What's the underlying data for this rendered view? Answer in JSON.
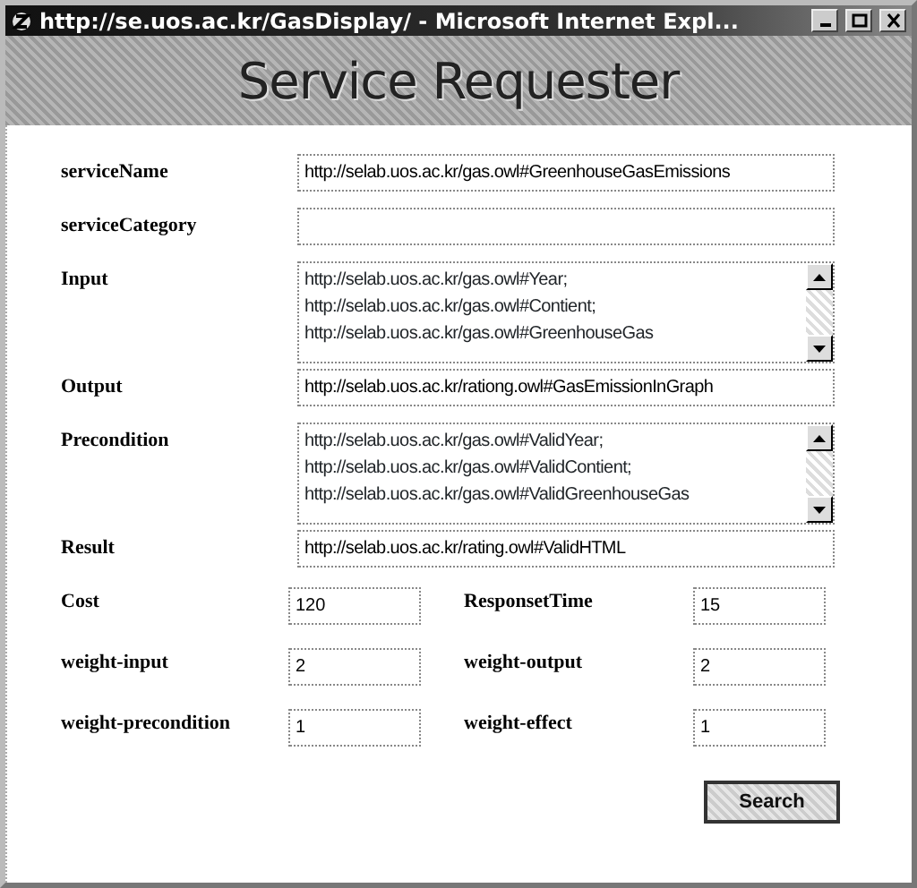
{
  "window": {
    "title": "http://se.uos.ac.kr/GasDisplay/ - Microsoft Internet Expl..."
  },
  "header": {
    "title": "Service Requester"
  },
  "fields": [
    {
      "label": "serviceName",
      "kind": "text",
      "value": "http://selab.uos.ac.kr/gas.owl#GreenhouseGasEmissions"
    },
    {
      "label": "serviceCategory",
      "kind": "text"
    },
    {
      "label": "Input",
      "kind": "textarea",
      "lines": [
        "http://selab.uos.ac.kr/gas.owl#Year;",
        "http://selab.uos.ac.kr/gas.owl#Contient;",
        "http://selab.uos.ac.kr/gas.owl#GreenhouseGas"
      ]
    },
    {
      "label": "Output",
      "kind": "text",
      "value": "http://selab.uos.ac.kr/rationg.owl#GasEmissionInGraph"
    },
    {
      "label": "Precondition",
      "kind": "textarea",
      "lines": [
        "http://selab.uos.ac.kr/gas.owl#ValidYear;",
        "http://selab.uos.ac.kr/gas.owl#ValidContient;",
        "http://selab.uos.ac.kr/gas.owl#ValidGreenhouseGas"
      ]
    },
    {
      "label": "Result",
      "kind": "text",
      "value": "http://selab.uos.ac.kr/rating.owl#ValidHTML"
    }
  ],
  "small_fields": [
    [
      {
        "label": "Cost",
        "value": "120"
      },
      {
        "label": "ResponsetTime",
        "value": "15"
      }
    ],
    [
      {
        "label": "weight-input",
        "value": "2"
      },
      {
        "label": "weight-output",
        "value": "2"
      }
    ],
    [
      {
        "label": "weight-precondition",
        "value": "1"
      },
      {
        "label": "weight-effect",
        "value": "1"
      }
    ]
  ],
  "buttons": [
    {
      "label": "Search"
    }
  ]
}
